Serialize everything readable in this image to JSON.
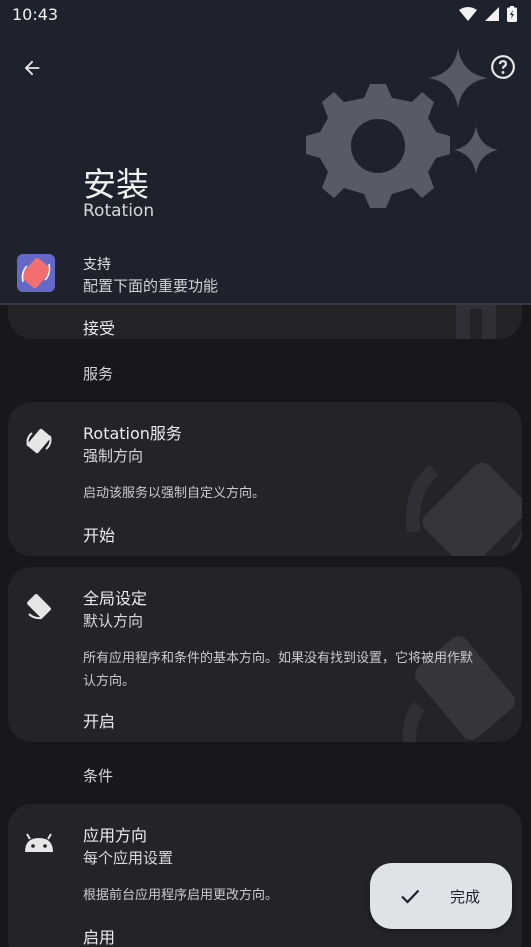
{
  "status_bar": {
    "time": "10:43"
  },
  "header": {
    "title": "安装",
    "subtitle": "Rotation",
    "support_title": "支持",
    "support_desc": "配置下面的重要功能",
    "accent_color": "#6468c8"
  },
  "top_card": {
    "action": "接受"
  },
  "sections": {
    "service_label": "服务",
    "conditions_label": "条件"
  },
  "cards": [
    {
      "icon": "rotation-service-icon",
      "title": "Rotation服务",
      "subtitle": "强制方向",
      "desc": "启动该服务以强制自定义方向。",
      "action": "开始"
    },
    {
      "icon": "global-settings-icon",
      "title": "全局设定",
      "subtitle": "默认方向",
      "desc": "所有应用程序和条件的基本方向。如果没有找到设置，它将被用作默认方向。",
      "action": "开启"
    },
    {
      "icon": "android-icon",
      "title": "应用方向",
      "subtitle": "每个应用设置",
      "desc": "根据前台应用程序启用更改方向。",
      "action": "启用"
    }
  ],
  "fab": {
    "label": "完成",
    "icon": "check-icon"
  }
}
